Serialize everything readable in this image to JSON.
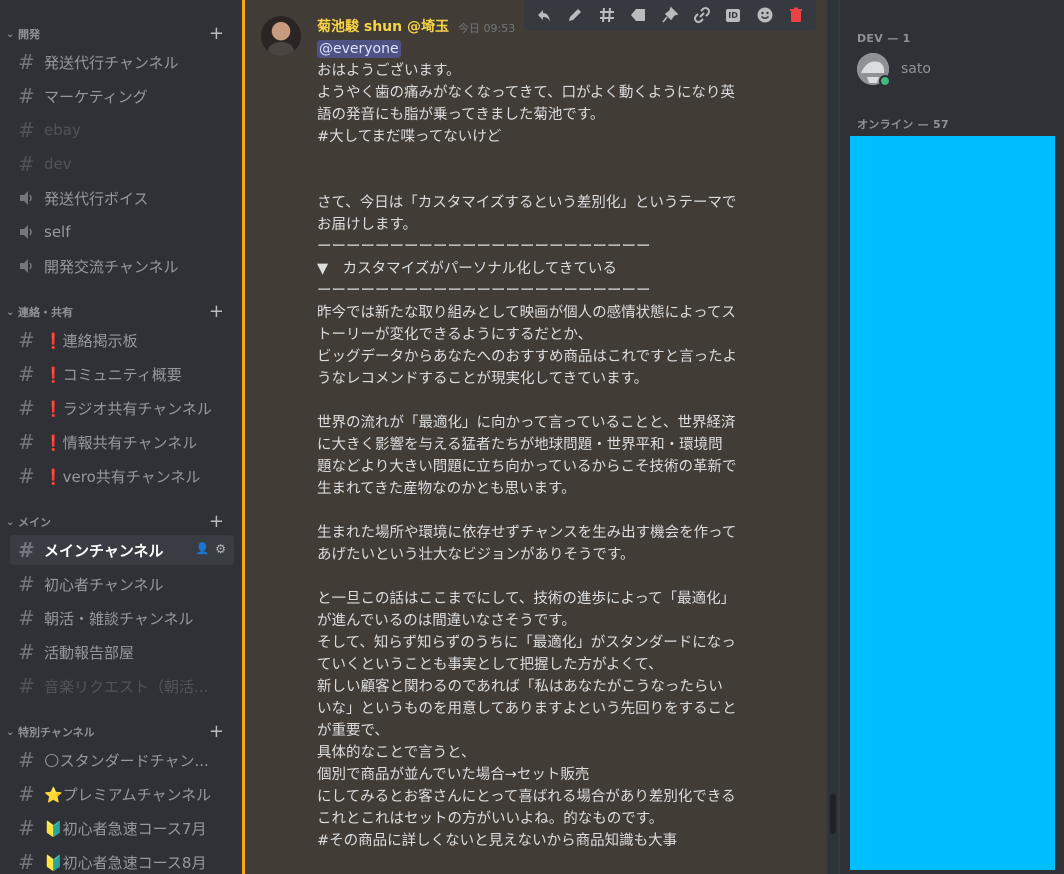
{
  "sidebar": {
    "categories": [
      {
        "label": "開発"
      },
      {
        "label": "連絡・共有"
      },
      {
        "label": "メイン"
      },
      {
        "label": "特別チャンネル"
      }
    ],
    "channels": [
      {
        "label": "発送代行チャンネル",
        "type": "text"
      },
      {
        "label": "マーケティング",
        "type": "text"
      },
      {
        "label": "ebay",
        "type": "text",
        "muted": true
      },
      {
        "label": "dev",
        "type": "text",
        "muted": true
      },
      {
        "label": "発送代行ボイス",
        "type": "voice"
      },
      {
        "label": "self",
        "type": "voice"
      },
      {
        "label": "開発交流チャンネル",
        "type": "voice"
      },
      {
        "label": "❗連絡掲示板",
        "type": "text"
      },
      {
        "label": "❗コミュニティ概要",
        "type": "text"
      },
      {
        "label": "❗ラジオ共有チャンネル",
        "type": "text"
      },
      {
        "label": "❗情報共有チャンネル",
        "type": "text"
      },
      {
        "label": "❗vero共有チャンネル",
        "type": "text"
      },
      {
        "label": "メインチャンネル",
        "type": "text",
        "active": true
      },
      {
        "label": "初心者チャンネル",
        "type": "text"
      },
      {
        "label": "朝活・雑談チャンネル",
        "type": "text"
      },
      {
        "label": "活動報告部屋",
        "type": "text"
      },
      {
        "label": "音楽リクエスト（朝活...",
        "type": "text",
        "muted": true
      },
      {
        "label": "🌕スタンダードチャン...",
        "type": "text"
      },
      {
        "label": "⭐プレミアムチャンネル",
        "type": "text"
      },
      {
        "label": "🔰初心者急速コース7月",
        "type": "text"
      },
      {
        "label": "🔰初心者急速コース8月",
        "type": "text"
      }
    ]
  },
  "message": {
    "author": "菊池駿 shun @埼玉",
    "timestamp": "今日 09:53",
    "mention": "@everyone",
    "lines": [
      "おはようございます。",
      "ようやく歯の痛みがなくなってきて、口がよく動くようになり英",
      "語の発音にも脂が乗ってきました菊池です。",
      "#大してまだ喋ってないけど",
      "",
      "",
      "さて、今日は「カスタマイズするという差別化」というテーマで",
      "お届けします。",
      "ーーーーーーーーーーーーーーーーーーーーーーー",
      "▼　カスタマイズがパーソナル化してきている",
      "ーーーーーーーーーーーーーーーーーーーーーーー",
      "昨今では新たな取り組みとして映画が個人の感情状態によってス",
      "トーリーが変化できるようにするだとか、",
      "ビッグデータからあなたへのおすすめ商品はこれですと言ったよ",
      "うなレコメンドすることが現実化してきています。",
      "",
      "世界の流れが「最適化」に向かって言っていることと、世界経済",
      "に大きく影響を与える猛者たちが地球問題・世界平和・環境問",
      "題などより大きい問題に立ち向かっているからこそ技術の革新で",
      "生まれてきた産物なのかとも思います。",
      "",
      "生まれた場所や環境に依存せずチャンスを生み出す機会を作って",
      "あげたいという壮大なビジョンがありそうです。",
      "",
      "と一旦この話はここまでにして、技術の進歩によって「最適化」",
      "が進んでいるのは間違いなさそうです。",
      "そして、知らず知らずのうちに「最適化」がスタンダードになっ",
      "ていくということも事実として把握した方がよくて、",
      "新しい顧客と関わるのであれば「私はあなたがこうなったらい",
      "いな」というものを用意してありますよという先回りをすること",
      "が重要で、",
      "具体的なことで言うと、",
      "個別で商品が並んでいた場合→セット販売",
      "にしてみるとお客さんにとって喜ばれる場合があり差別化できる",
      "これとこれはセットの方がいいよね。的なものです。",
      "#その商品に詳しくないと見えないから商品知識も大事"
    ]
  },
  "toolbar": {
    "icons": [
      "reply-icon",
      "edit-icon",
      "thread-icon",
      "tag-icon",
      "pin-icon",
      "link-icon",
      "id-icon",
      "emoji-icon",
      "delete-icon"
    ],
    "id_label": "ID"
  },
  "members": {
    "dev_header": "DEV — 1",
    "member_name": "sato",
    "online_header": "オンライン — 57"
  },
  "colors": {
    "highlight_bar": "#faa61a",
    "author": "#f8d34a",
    "mention_bg": "#4f5284",
    "redaction": "#00bfff",
    "delete": "#ed4245"
  }
}
